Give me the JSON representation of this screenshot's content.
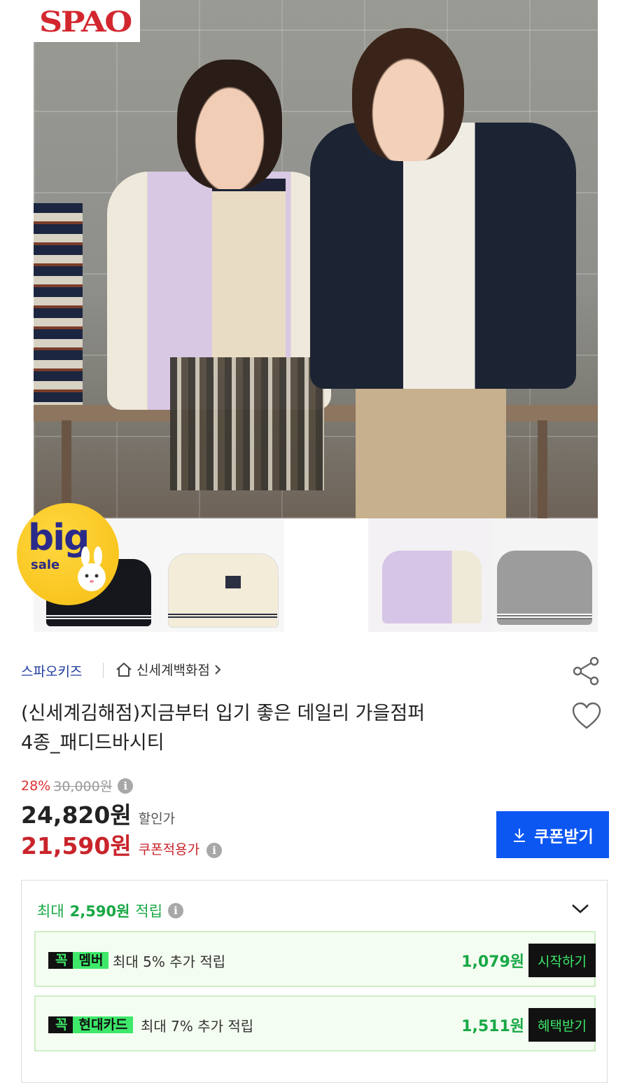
{
  "brand_logo": "SPAO",
  "badge": {
    "big": "big",
    "sale": "sale"
  },
  "seller": {
    "brand": "스파오키즈",
    "store": "신세계백화점"
  },
  "icons": {
    "store": "home-icon",
    "store_chevron": "chevron-right-icon",
    "share": "share-icon",
    "wishlist": "heart-icon",
    "info": "info-icon",
    "download": "download-icon",
    "expand": "chevron-down-icon"
  },
  "product": {
    "title_line1": "(신세계김해점)지금부터 입기 좋은 데일리 가을점퍼",
    "title_line2": "4종_패디드바시티"
  },
  "price": {
    "discount_rate": "28%",
    "original": "30,000원",
    "sale": "24,820원",
    "sale_label": "할인가",
    "coupon": "21,590원",
    "coupon_label": "쿠폰적용가",
    "coupon_button": "쿠폰받기"
  },
  "points": {
    "prefix": "최대",
    "amount": "2,590원",
    "suffix": "적립",
    "benefits": [
      {
        "tag_k": "꼭",
        "tag_name": "멤버",
        "desc": "최대 5% 추가 적립",
        "amount": "1,079원",
        "button": "시작하기"
      },
      {
        "tag_k": "꼭",
        "tag_name": "현대카드",
        "desc": "최대 7% 추가 적립",
        "amount": "1,511원",
        "button": "혜택받기"
      }
    ]
  },
  "colors": {
    "accent_blue": "#0c57f2",
    "coupon_red": "#c9242b",
    "points_green": "#18a845",
    "member_green": "#3ee86a"
  }
}
